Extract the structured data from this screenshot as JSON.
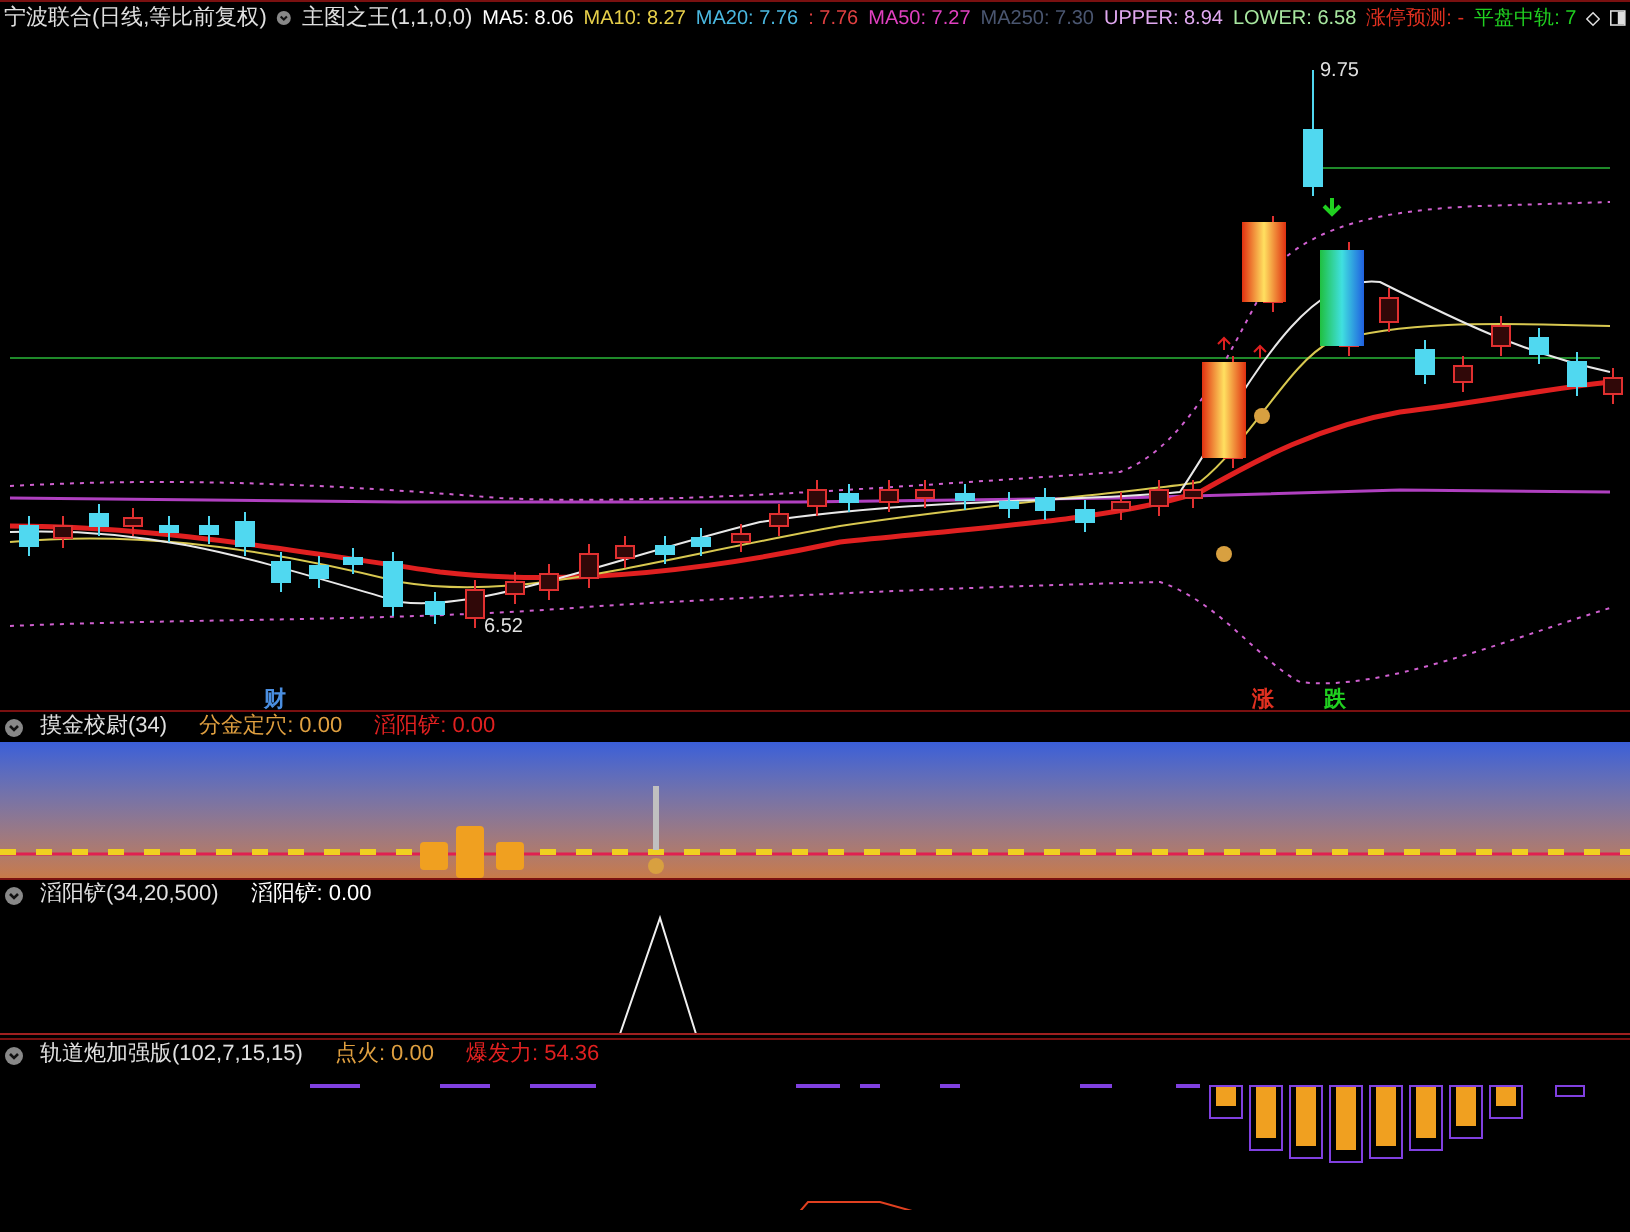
{
  "title_bar": {
    "stock": "宁波联合(日线,等比前复权)",
    "indicator": "主图之王(1,1,0,0)"
  },
  "main_legend": [
    {
      "text": "MA5: 8.06",
      "color": "#ffffff"
    },
    {
      "text": "MA10: 8.27",
      "color": "#e8d04a"
    },
    {
      "text": "MA20: 7.76",
      "color": "#4ab8e0"
    },
    {
      "text": ": 7.76",
      "color": "#e04040"
    },
    {
      "text": "MA50: 7.27",
      "color": "#e040c0"
    },
    {
      "text": "MA250: 7.30",
      "color": "#4a5670"
    },
    {
      "text": "UPPER: 8.94",
      "color": "#e0a8f0"
    },
    {
      "text": "LOWER: 6.58",
      "color": "#a8e8a0"
    },
    {
      "text": "涨停预测: -",
      "color": "#e03020"
    },
    {
      "text": "平盘中轨: 7",
      "color": "#20d020"
    }
  ],
  "chart_labels": [
    {
      "text": "9.75",
      "kind": "price"
    },
    {
      "text": "6.52",
      "kind": "price"
    },
    {
      "text": "财",
      "kind": "mark"
    },
    {
      "text": "涨",
      "kind": "mark"
    },
    {
      "text": "跌",
      "kind": "mark"
    }
  ],
  "panels": [
    {
      "title": "摸金校尉(34)",
      "values": [
        {
          "text": "分金定穴: 0.00",
          "color": "#e0a040"
        },
        {
          "text": "滔阳铲: 0.00",
          "color": "#e02020"
        }
      ]
    },
    {
      "title": "滔阳铲(34,20,500)",
      "values": [
        {
          "text": "滔阳铲: 0.00",
          "color": "#ffffff"
        }
      ]
    },
    {
      "title": "轨道炮加强版(102,7,15,15)",
      "values": [
        {
          "text": "点火: 0.00",
          "color": "#e0a040"
        },
        {
          "text": "爆发力: 54.36",
          "color": "#e02020"
        }
      ]
    }
  ]
}
